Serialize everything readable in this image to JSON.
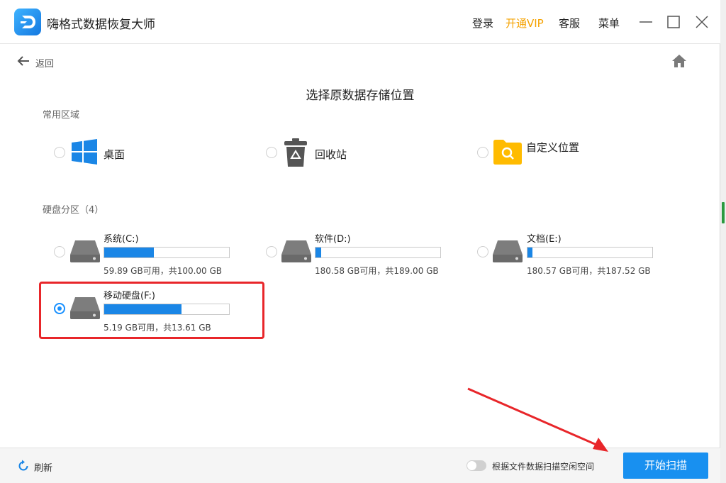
{
  "app": {
    "title": "嗨格式数据恢复大师"
  },
  "titlebar": {
    "menu": [
      "登录",
      "开通VIP",
      "客服",
      "菜单"
    ],
    "vip_color": "#f5a200"
  },
  "nav": {
    "back_label": "返回"
  },
  "page": {
    "title": "选择原数据存储位置"
  },
  "common": {
    "label": "常用区域",
    "items": [
      {
        "label": "桌面",
        "icon": "windows-icon"
      },
      {
        "label": "回收站",
        "icon": "recycle-bin-icon"
      },
      {
        "label": "自定义位置",
        "icon": "folder-search-icon"
      }
    ]
  },
  "disks": {
    "label": "硬盘分区（4）",
    "items": [
      {
        "name": "系统(C:)",
        "capacity": "59.89 GB可用，共100.00 GB",
        "used_fraction": 0.4,
        "selected": false
      },
      {
        "name": "软件(D:)",
        "capacity": "180.58 GB可用，共189.00 GB",
        "used_fraction": 0.045,
        "selected": false
      },
      {
        "name": "文档(E:)",
        "capacity": "180.57 GB可用，共187.52 GB",
        "used_fraction": 0.037,
        "selected": false
      },
      {
        "name": "移动硬盘(F:)",
        "capacity": "5.19 GB可用，共13.61 GB",
        "used_fraction": 0.62,
        "selected": true
      }
    ]
  },
  "footer": {
    "refresh_label": "刷新",
    "toggle_label": "根据文件数据扫描空闲空间",
    "toggle_on": false,
    "start_label": "开始扫描"
  },
  "colors": {
    "accent": "#1890f0",
    "bar_fill": "#1a86e6",
    "annotation": "#e8262a"
  }
}
